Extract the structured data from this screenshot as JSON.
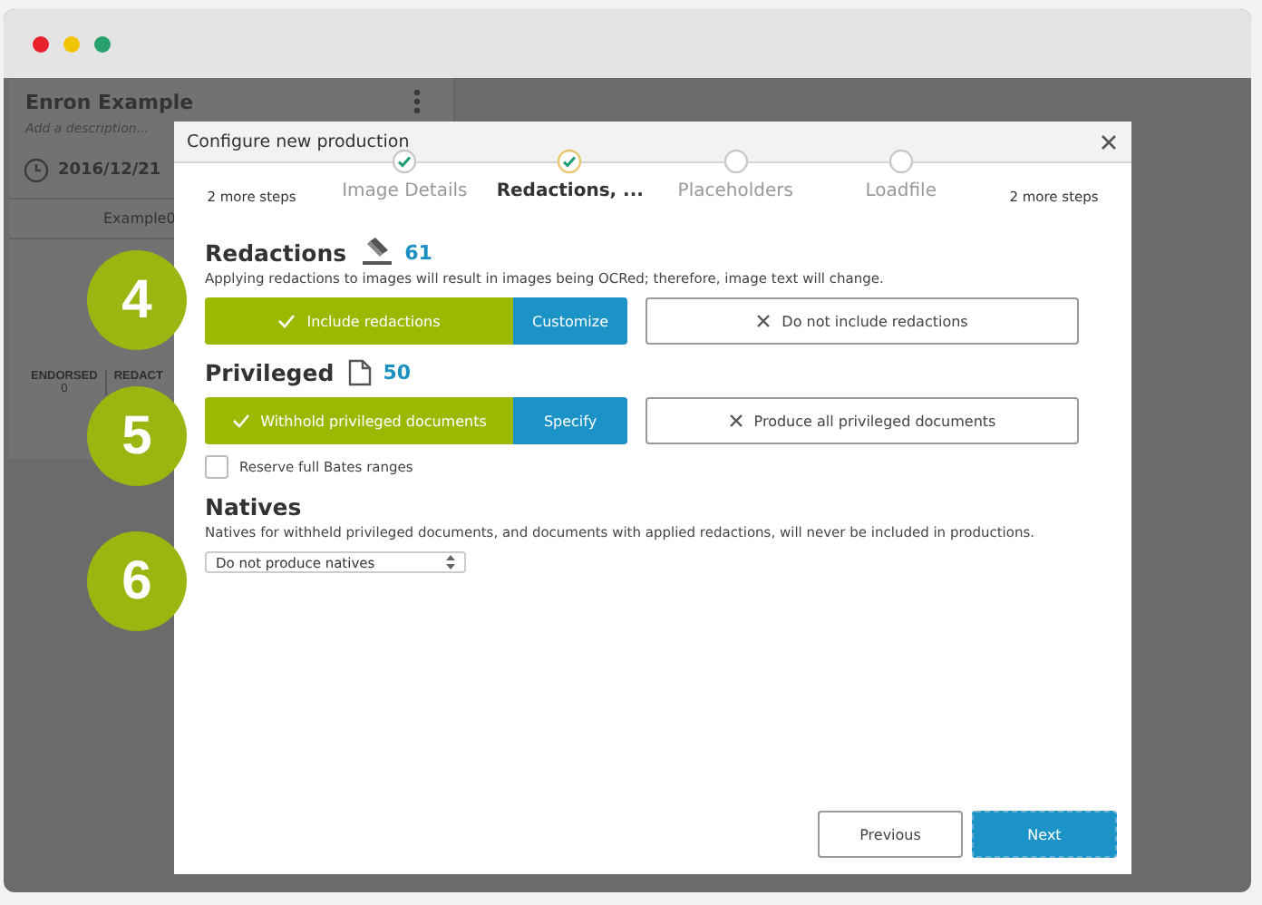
{
  "background": {
    "title": "Enron Example",
    "description": "Add a description...",
    "date": "2016/12/21",
    "column": "Example0",
    "stats": [
      {
        "label": "ENDORSED",
        "value": "0"
      },
      {
        "label": "REDACT"
      }
    ]
  },
  "modal": {
    "title": "Configure new production",
    "steps": [
      {
        "kind": "more",
        "label": "2 more steps"
      },
      {
        "kind": "step",
        "label": "Image Details",
        "done": true,
        "selected": false
      },
      {
        "kind": "step",
        "label": "Redactions, ...",
        "done": true,
        "selected": true
      },
      {
        "kind": "step",
        "label": "Placeholders",
        "done": false,
        "selected": false
      },
      {
        "kind": "step",
        "label": "Loadfile",
        "done": false,
        "selected": false
      },
      {
        "kind": "more",
        "label": "2 more steps"
      }
    ],
    "sections": [
      {
        "kind": "choice",
        "callout": "4",
        "title": "Redactions",
        "count": "61",
        "description": "Applying redactions to images will result in images being OCRed; therefore, image text will change.",
        "options": [
          {
            "label": "Include redactions",
            "selected": true,
            "extra": "Customize"
          },
          {
            "label": "Do not include redactions",
            "selected": false
          }
        ]
      },
      {
        "kind": "choice",
        "callout": "5",
        "title": "Privileged",
        "count": "50",
        "options": [
          {
            "label": "Withhold privileged documents",
            "selected": true,
            "extra": "Specify"
          },
          {
            "label": "Produce all privileged documents",
            "selected": false
          }
        ],
        "checkbox": {
          "label": "Reserve full Bates ranges",
          "checked": false
        }
      },
      {
        "kind": "select",
        "callout": "6",
        "title": "Natives",
        "description": "Natives for withheld privileged documents, and documents with applied redactions, will never be included in productions.",
        "value": "Do not produce natives"
      }
    ],
    "buttons": [
      {
        "label": "Previous",
        "kind": "secondary"
      },
      {
        "label": "Next",
        "kind": "primary"
      }
    ]
  }
}
